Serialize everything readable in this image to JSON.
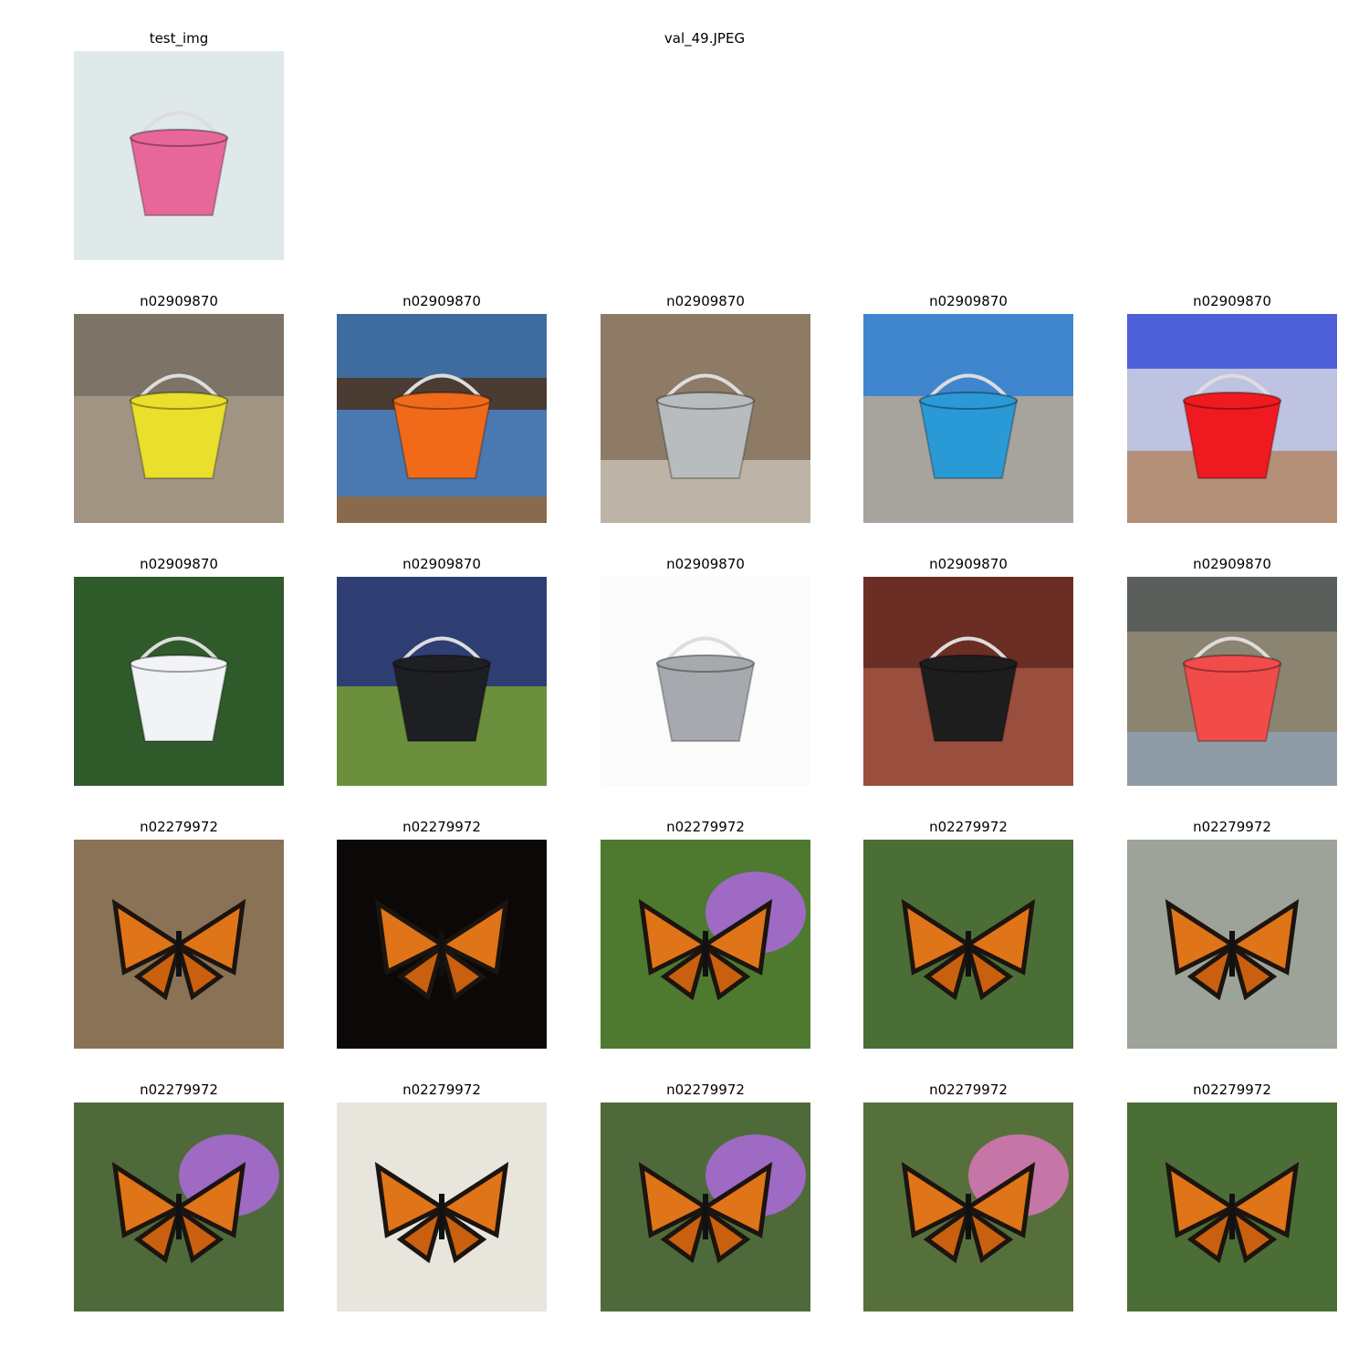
{
  "figure": {
    "query_title": "val_49.JPEG",
    "query": {
      "label": "test_img",
      "scene": "snow",
      "bucket_color": "#e8679a"
    },
    "rows": [
      {
        "tiles": [
          {
            "label": "n02909870",
            "scene": "sand",
            "bucket_color": "#e9df2c"
          },
          {
            "label": "n02909870",
            "scene": "sea",
            "bucket_color": "#f06a1a"
          },
          {
            "label": "n02909870",
            "scene": "wood",
            "bucket_color": "#b9bcbf"
          },
          {
            "label": "n02909870",
            "scene": "beach",
            "bucket_color": "#2a9ad6"
          },
          {
            "label": "n02909870",
            "scene": "sky",
            "bucket_color": "#ef1a1f"
          }
        ]
      },
      {
        "tiles": [
          {
            "label": "n02909870",
            "scene": "garden",
            "bucket_color": "#f2f3f7"
          },
          {
            "label": "n02909870",
            "scene": "shed",
            "bucket_color": "#1e1f22"
          },
          {
            "label": "n02909870",
            "scene": "white",
            "bucket_color": "#a6a9ad"
          },
          {
            "label": "n02909870",
            "scene": "brick",
            "bucket_color": "#1d1d1d"
          },
          {
            "label": "n02909870",
            "scene": "patio",
            "bucket_color": "#f24c4a"
          }
        ]
      },
      {
        "tiles": [
          {
            "label": "n02279972",
            "scene": "bark"
          },
          {
            "label": "n02279972",
            "scene": "night"
          },
          {
            "label": "n02279972",
            "scene": "flowers"
          },
          {
            "label": "n02279972",
            "scene": "leaves"
          },
          {
            "label": "n02279972",
            "scene": "stone"
          }
        ]
      },
      {
        "tiles": [
          {
            "label": "n02279972",
            "scene": "lilac"
          },
          {
            "label": "n02279972",
            "scene": "card"
          },
          {
            "label": "n02279972",
            "scene": "lilac"
          },
          {
            "label": "n02279972",
            "scene": "pink"
          },
          {
            "label": "n02279972",
            "scene": "leaves"
          }
        ]
      }
    ]
  }
}
